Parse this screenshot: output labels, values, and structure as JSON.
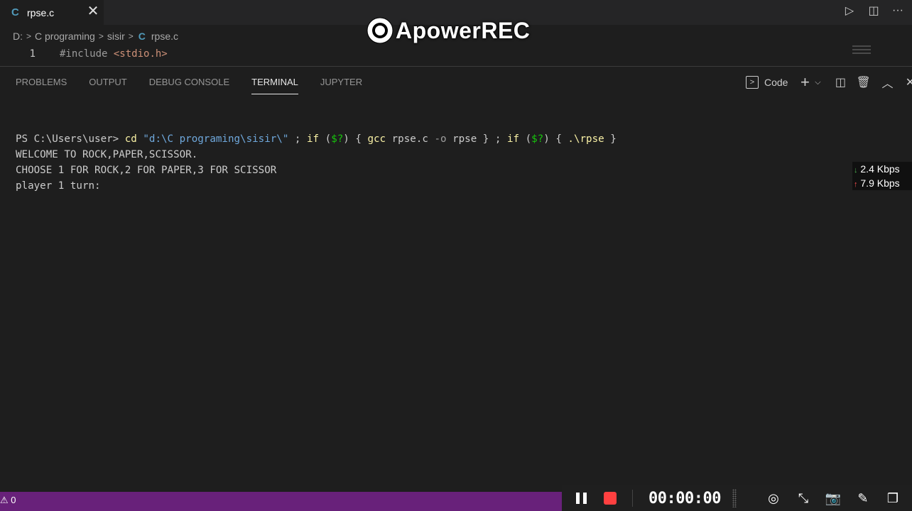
{
  "tab": {
    "icon": "C",
    "name": "rpse.c",
    "close": "✕"
  },
  "top_actions": {
    "run": "▷",
    "split": "◫",
    "more": "···"
  },
  "breadcrumb": {
    "drive": "D:",
    "folder1": "C programing",
    "folder2": "sisir",
    "file_icon": "C",
    "file": "rpse.c"
  },
  "editor": {
    "line_number": "1",
    "include_kw": "#include",
    "include_file": "<stdio.h>"
  },
  "watermark": {
    "text": "ApowerREC"
  },
  "panel": {
    "tabs": [
      "PROBLEMS",
      "OUTPUT",
      "DEBUG CONSOLE",
      "TERMINAL",
      "JUPYTER"
    ],
    "active_tab": "TERMINAL",
    "shell_label": "Code"
  },
  "terminal": {
    "prompt": "PS C:\\Users\\user> ",
    "cmd_cd": "cd",
    "cmd_path": "\"d:\\C programing\\sisir\\\"",
    "sep1": " ; ",
    "if1": "if",
    "lp1": " (",
    "status1": "$?",
    "rp1": ") { ",
    "gcc": "gcc",
    "gcc_args": " rpse.c ",
    "flag_o": "-o",
    "out_name": " rpse } ; ",
    "if2": "if",
    "lp2": " (",
    "status2": "$?",
    "rp2": ") { ",
    "exe": ".\\rpse",
    "close_brace": " }",
    "out1": "WELCOME TO ROCK,PAPER,SCISSOR.",
    "out2": "CHOOSE 1 FOR ROCK,2 FOR PAPER,3 FOR SCISSOR",
    "out3": "player 1 turn:"
  },
  "netspeed": {
    "down_arrow": "↓",
    "down": "2.4 Kbps",
    "up_arrow": "↑",
    "up": "7.9 Kbps"
  },
  "statusbar": {
    "warnings": "⚠ 0"
  },
  "recorder": {
    "timer": "00:00:00"
  }
}
